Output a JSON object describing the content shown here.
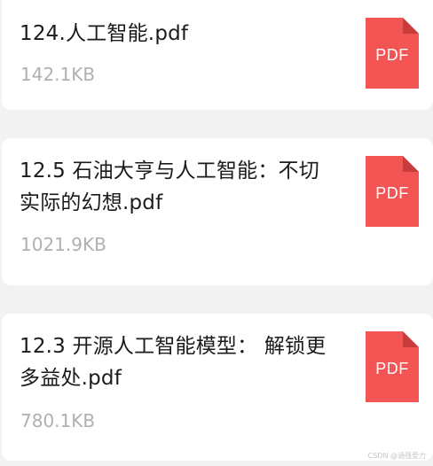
{
  "files": [
    {
      "name": "124.人工智能.pdf",
      "size": "142.1KB",
      "type_label": "PDF",
      "icon": "pdf-file-icon"
    },
    {
      "name": "12.5 石油大亨与人工智能：不切实际的幻想.pdf",
      "size": "1021.9KB",
      "type_label": "PDF",
      "icon": "pdf-file-icon"
    },
    {
      "name": "12.3 开源人工智能模型： 解锁更多益处.pdf",
      "size": "780.1KB",
      "type_label": "PDF",
      "icon": "pdf-file-icon"
    }
  ],
  "watermark": "CSDN @涵强爱力",
  "colors": {
    "background": "#f2f2f2",
    "card": "#ffffff",
    "pdf_icon": "#f35555",
    "pdf_icon_fold": "#c83c3c",
    "file_name": "#1b1b1b",
    "file_size": "#b0b0b0"
  }
}
